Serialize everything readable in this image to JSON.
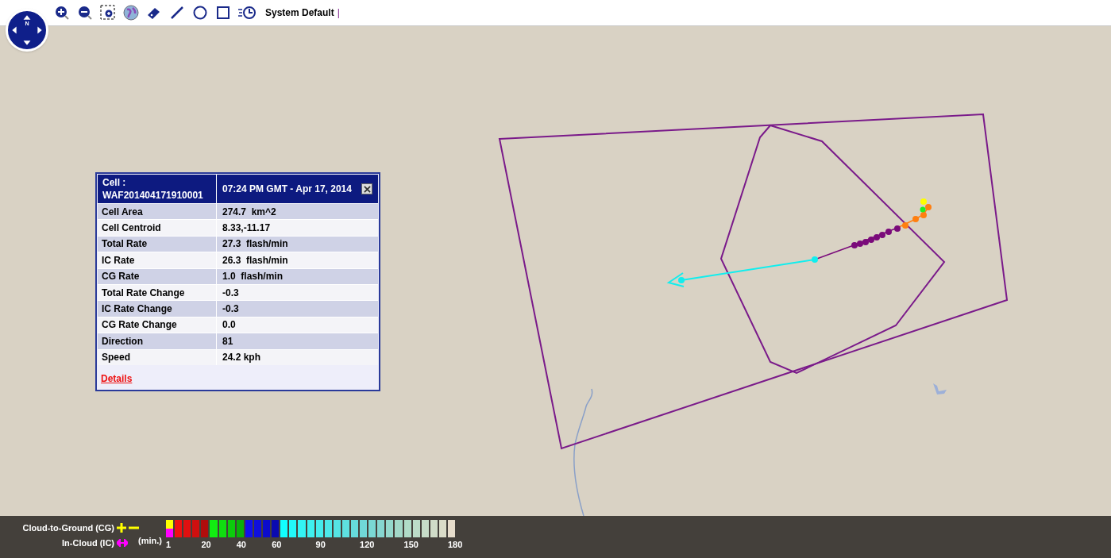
{
  "compass": {
    "north_label": "N"
  },
  "toolbar": {
    "style_label": "System Default",
    "separator": "|"
  },
  "popup": {
    "title_label": "Cell :",
    "title_id": "WAF201404171910001",
    "timestamp": "07:24 PM GMT - Apr 17, 2014",
    "rows": [
      {
        "label": "Cell Area",
        "value": "274.7  km^2"
      },
      {
        "label": "Cell Centroid",
        "value": "8.33,-11.17"
      },
      {
        "label": "Total Rate",
        "value": "27.3  flash/min"
      },
      {
        "label": "IC Rate",
        "value": "26.3  flash/min"
      },
      {
        "label": "CG Rate",
        "value": "1.0  flash/min"
      },
      {
        "label": "Total Rate Change",
        "value": "-0.3"
      },
      {
        "label": "IC Rate Change",
        "value": "-0.3"
      },
      {
        "label": "CG Rate Change",
        "value": "0.0"
      },
      {
        "label": "Direction",
        "value": "81"
      },
      {
        "label": "Speed",
        "value": "24.2 kph"
      }
    ],
    "link": "Details"
  },
  "legend": {
    "cg_label": "Cloud-to-Ground (CG)",
    "ic_label": "In-Cloud (IC)",
    "unit": "(min.)",
    "swatches": [
      {
        "kind": "split",
        "parts": [
          {
            "color": "#ffff00"
          },
          {
            "color": "#ff00ff"
          }
        ],
        "label": "1"
      },
      {
        "kind": "plain",
        "color": "#ee1111"
      },
      {
        "kind": "plain",
        "color": "#e01010"
      },
      {
        "kind": "plain",
        "color": "#d00f0f"
      },
      {
        "kind": "plain",
        "color": "#b00c0c",
        "label": "20"
      },
      {
        "kind": "plain",
        "color": "#11ee11"
      },
      {
        "kind": "plain",
        "color": "#10dd10"
      },
      {
        "kind": "plain",
        "color": "#0ccc0c"
      },
      {
        "kind": "plain",
        "color": "#0ab00a",
        "label": "40"
      },
      {
        "kind": "plain",
        "color": "#1111ee"
      },
      {
        "kind": "plain",
        "color": "#0f0fdd"
      },
      {
        "kind": "plain",
        "color": "#0c0ccc"
      },
      {
        "kind": "plain",
        "color": "#0a0ab0",
        "label": "60"
      },
      {
        "kind": "plain",
        "color": "#11ffff"
      },
      {
        "kind": "plain",
        "color": "#22f8f8"
      },
      {
        "kind": "plain",
        "color": "#33f4f4"
      },
      {
        "kind": "plain",
        "color": "#3ef0ef"
      },
      {
        "kind": "plain",
        "color": "#44ecec",
        "label": "90"
      },
      {
        "kind": "plain",
        "color": "#4ce8e8"
      },
      {
        "kind": "plain",
        "color": "#55e4e4"
      },
      {
        "kind": "plain",
        "color": "#5ee0e0"
      },
      {
        "kind": "plain",
        "color": "#66dcdc"
      },
      {
        "kind": "plain",
        "color": "#70d8d8",
        "label": "120"
      },
      {
        "kind": "plain",
        "color": "#7ad8d4"
      },
      {
        "kind": "plain",
        "color": "#86d6d0"
      },
      {
        "kind": "plain",
        "color": "#94d8cc"
      },
      {
        "kind": "plain",
        "color": "#a2d8c8"
      },
      {
        "kind": "plain",
        "color": "#b0dcc8",
        "label": "150"
      },
      {
        "kind": "plain",
        "color": "#bcdcc8"
      },
      {
        "kind": "plain",
        "color": "#c6dcc8"
      },
      {
        "kind": "plain",
        "color": "#d0dcc8"
      },
      {
        "kind": "plain",
        "color": "#dadcc8"
      },
      {
        "kind": "plain",
        "color": "#e6dccb",
        "label": "180"
      }
    ]
  }
}
